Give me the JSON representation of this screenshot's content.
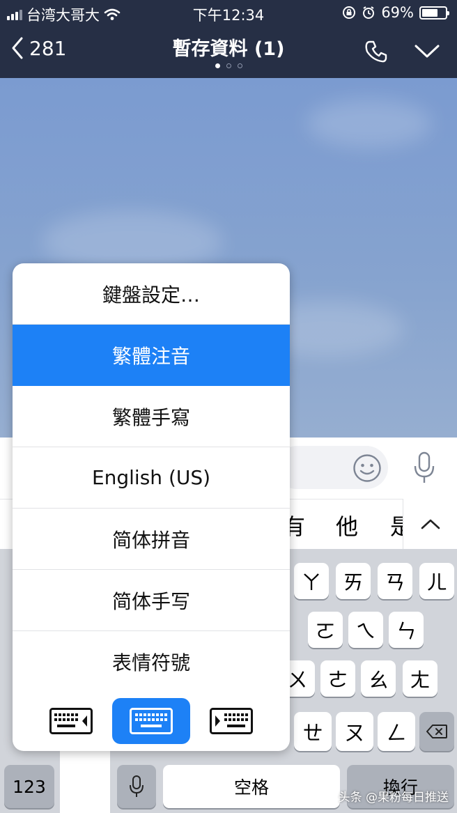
{
  "status_bar": {
    "carrier": "台湾大哥大",
    "time": "下午12:34",
    "battery_percent": "69%",
    "battery_level": 0.69
  },
  "nav": {
    "back_count": "281",
    "title": "暫存資料 (1)",
    "page_count": 3,
    "current_page": 1
  },
  "candidates": [
    "有",
    "他",
    "是"
  ],
  "keyboard": {
    "rows": [
      [
        "ㄚ",
        "ㄞ",
        "ㄢ",
        "ㄦ"
      ],
      [
        "ㄛ",
        "ㄟ",
        "ㄣ"
      ],
      [
        "ㄨ",
        "ㄜ",
        "ㄠ",
        "ㄤ"
      ],
      [
        "ㄝ",
        "ㄡ",
        "ㄥ"
      ]
    ],
    "numbers_key": "123",
    "space_key": "空格",
    "return_key": "換行"
  },
  "input_menu": {
    "items": [
      "鍵盤設定…",
      "繁體注音",
      "繁體手寫",
      "English (US)",
      "简体拼音",
      "简体手写",
      "表情符號"
    ],
    "selected_index": 1,
    "layout_options": [
      "left",
      "center",
      "right"
    ],
    "active_layout": "center"
  },
  "watermark": "头条 @果粉每日推送",
  "colors": {
    "nav_bg": "#262f45",
    "accent": "#1d81f6",
    "keyboard_bg": "#d1d4da"
  },
  "icons": {
    "back": "chevron-left-icon",
    "call": "phone-icon",
    "menu": "chevron-down-icon",
    "emoji": "smiley-icon",
    "voice": "microphone-icon",
    "delete": "backspace-icon"
  }
}
